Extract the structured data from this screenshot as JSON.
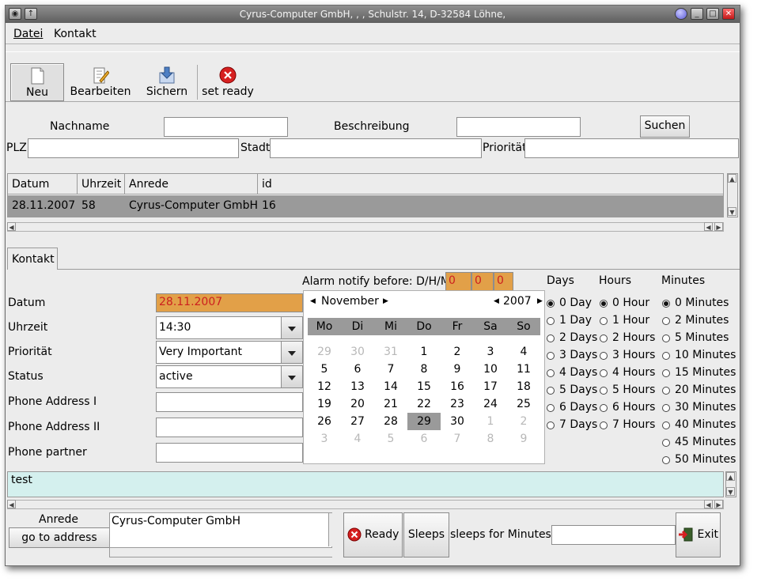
{
  "window": {
    "title": "Cyrus-Computer GmbH, , , Schulstr. 14, D-32584 Löhne,"
  },
  "menu": {
    "file": "Datei",
    "contact": "Kontakt"
  },
  "toolbar": {
    "new": "Neu",
    "edit": "Bearbeiten",
    "save": "Sichern",
    "set_ready": "set ready"
  },
  "search": {
    "lastname_label": "Nachname",
    "lastname_value": "",
    "description_label": "Beschreibung",
    "description_value": "",
    "search_button": "Suchen",
    "zip_label": "PLZ",
    "city_label": "Stadt",
    "priority_label": "Priorität"
  },
  "table": {
    "headers": [
      "Datum",
      "Uhrzeit",
      "Anrede",
      "id"
    ],
    "rows": [
      [
        "28.11.2007",
        "58",
        "Cyrus-Computer GmbH",
        "16"
      ]
    ]
  },
  "tabs": {
    "contact": "Kontakt"
  },
  "alarm": {
    "label": "Alarm notify before: D/H/M",
    "d": "0",
    "h": "0",
    "m": "0"
  },
  "form": {
    "date_label": "Datum",
    "date_value": "28.11.2007",
    "time_label": "Uhrzeit",
    "time_value": "14:30",
    "priority_label": "Priorität",
    "priority_value": "Very Important",
    "status_label": "Status",
    "status_value": "active",
    "phone1_label": "Phone Address I",
    "phone2_label": "Phone Address II",
    "partner_label": "Phone partner"
  },
  "calendar": {
    "month": "November",
    "year": "2007",
    "weekdays": [
      "Mo",
      "Di",
      "Mi",
      "Do",
      "Fr",
      "Sa",
      "So"
    ],
    "weeks": [
      [
        "29",
        "30",
        "31",
        "1",
        "2",
        "3",
        "4"
      ],
      [
        "5",
        "6",
        "7",
        "8",
        "9",
        "10",
        "11"
      ],
      [
        "12",
        "13",
        "14",
        "15",
        "16",
        "17",
        "18"
      ],
      [
        "19",
        "20",
        "21",
        "22",
        "23",
        "24",
        "25"
      ],
      [
        "26",
        "27",
        "28",
        "29",
        "30",
        "1",
        "2"
      ],
      [
        "3",
        "4",
        "5",
        "6",
        "7",
        "8",
        "9"
      ]
    ],
    "selected": "29"
  },
  "radios": {
    "days_header": "Days",
    "hours_header": "Hours",
    "minutes_header": "Minutes",
    "days": [
      "0 Day",
      "1 Day",
      "2 Days",
      "3 Days",
      "4 Days",
      "5 Days",
      "6 Days",
      "7 Days"
    ],
    "hours": [
      "0 Hour",
      "1 Hour",
      "2 Hours",
      "3 Hours",
      "4 Hours",
      "5 Hours",
      "6 Hours",
      "7 Hours"
    ],
    "minutes": [
      "0 Minutes",
      "2 Minutes",
      "5 Minutes",
      "10 Minutes",
      "15 Minutes",
      "20 Minutes",
      "30 Minutes",
      "40 Minutes",
      "45 Minutes",
      "50 Minutes"
    ]
  },
  "notes": {
    "text": "test"
  },
  "bottom": {
    "salutation_label": "Anrede",
    "goto_address": "go to address",
    "salutation_value": "Cyrus-Computer GmbH",
    "ready": "Ready",
    "sleeps": "Sleeps",
    "sleeps_minutes_label": "sleeps for Minutes",
    "sleeps_minutes_value": "",
    "exit": "Exit"
  },
  "colors": {
    "accent": "#e2a048",
    "red": "#cc1f1f",
    "notes_bg": "#d4f0ee",
    "selection": "#9a9a9a"
  }
}
